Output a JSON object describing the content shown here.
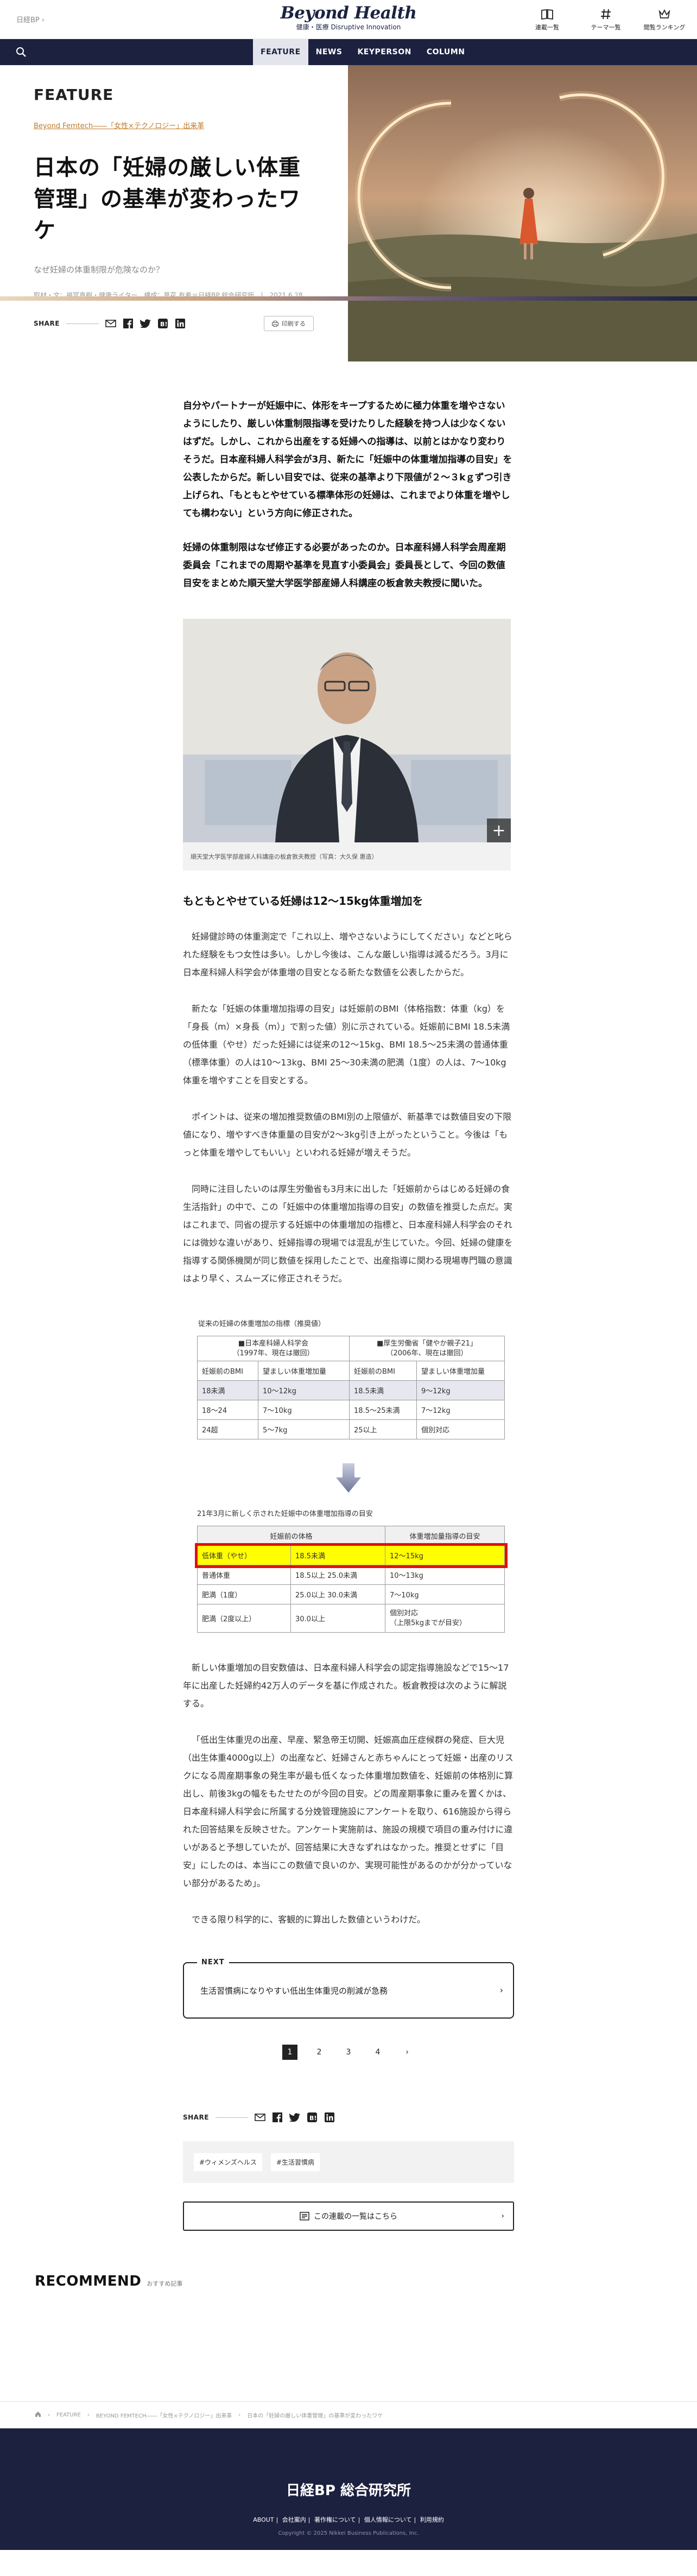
{
  "header": {
    "site_link": "日経BP ›",
    "logo_main": "Beyond Health",
    "logo_sub": "健康・医療  Disruptive Innovation",
    "icons": [
      {
        "icon": "book-icon",
        "label": "連載一覧"
      },
      {
        "icon": "hash-icon",
        "label": "テーマ一覧"
      },
      {
        "icon": "crown-icon",
        "label": "閲覧ランキング"
      }
    ]
  },
  "nav": {
    "tabs": [
      "FEATURE",
      "NEWS",
      "KEYPERSON",
      "COLUMN"
    ],
    "active": "FEATURE"
  },
  "hero": {
    "section_label": "FEATURE",
    "series_link": "Beyond Femtech――「女性×テクノロジー」出来革",
    "title": "日本の「妊婦の厳しい体重管理」の基準が変わったワケ",
    "subtitle": "なぜ妊婦の体重制限が危険なのか？",
    "credit": "取材・文：福冨直樹・健康ライター、構成：草花 有希＝日経BP 総合研究所　|　2021.6.28",
    "share_label": "SHARE",
    "print_label": "印刷する"
  },
  "article": {
    "lead1": "自分やパートナーが妊娠中に、体形をキープするために極力体重を増やさないようにしたり、厳しい体重制限指導を受けたりした経験を持つ人は少なくないはずだ。しかし、これから出産をする妊婦への指導は、以前とはかなり変わりそうだ。日本産科婦人科学会が3月、新たに「妊娠中の体重増加指導の目安」を公表したからだ。新しい目安では、従来の基準より下限値が２～３kｇずつ引き上げられ、「もともとやせている標準体形の妊婦は、これまでより体重を増やしても構わない」という方向に修正された。",
    "lead2": "妊婦の体重制限はなぜ修正する必要があったのか。日本産科婦人科学会周産期委員会「これまでの周期や基準を見直す小委員会」委員長として、今回の数値目安をまとめた順天堂大学医学部産婦人科講座の板倉敦夫教授に聞いた。",
    "photo_caption": "順天堂大学医学部産婦人科講座の板倉敦夫教授（写真：大久保 惠造）",
    "section1_heading": "もともとやせている妊婦は12～15kg体重増加を",
    "para1": "妊婦健診時の体重測定で「これ以上、増やさないようにしてください」などと叱られた経験をもつ女性は多い。しかし今後は、こんな厳しい指導は減るだろう。3月に日本産科婦人科学会が体重増の目安となる新たな数値を公表したからだ。",
    "para2": "新たな「妊娠の体重増加指導の目安」は妊娠前のBMI（体格指数：体重（kg）を「身長（m）×身長（m）」で割った値）別に示されている。妊娠前にBMI 18.5未満の低体重（やせ）だった妊婦には従来の12～15kg、BMI 18.5～25未満の普通体重（標準体重）の人は10～13kg、BMI 25～30未満の肥満（1度）の人は、7～10kg体重を増やすことを目安とする。",
    "para3": "ポイントは、従来の増加推奨数値のBMI別の上限値が、新基準では数値目安の下限値になり、増やすべき体重量の目安が2～3kg引き上がったということ。今後は「もっと体重を増やしてもいい」といわれる妊婦が増えそうだ。",
    "para4": "同時に注目したいのは厚生労働省も3月末に出した「妊娠前からはじめる妊婦の食生活指針」の中で、この「妊娠中の体重増加指導の目安」の数値を推奨した点だ。実はこれまで、同省の提示する妊娠中の体重増加の指標と、日本産科婦人科学会のそれには微妙な違いがあり、妊婦指導の現場では混乱が生じていた。今回、妊婦の健康を指導する関係機関が同じ数値を採用したことで、出産指導に関わる現場専門職の意識はより早く、スムーズに修正されそうだ。",
    "table1": {
      "title": "従来の妊婦の体重増加の指標（推奨値）",
      "group_a": "■日本産科婦人科学会\n（1997年、現在は撤回）",
      "group_b": "■厚生労働省「健やか親子21」\n（2006年、現在は撤回）",
      "col_bmi": "妊娠前のBMI",
      "col_gain": "望ましい体重増加量",
      "rows": [
        [
          "18未満",
          "10～12kg",
          "18.5未満",
          "9～12kg"
        ],
        [
          "18～24",
          "7～10kg",
          "18.5～25未満",
          "7～12kg"
        ],
        [
          "24超",
          "5～7kg",
          "25以上",
          "個別対応"
        ]
      ]
    },
    "table2": {
      "title": "21年3月に新しく示された妊娠中の体重増加指導の目安",
      "col_a": "妊娠前の体格",
      "col_b": "体重増加量指導の目安",
      "rows": [
        [
          "低体重（やせ）",
          "18.5未満",
          "12～15kg"
        ],
        [
          "普通体重",
          "18.5以上 25.0未満",
          "10～13kg"
        ],
        [
          "肥満（1度）",
          "25.0以上 30.0未満",
          "7～10kg"
        ],
        [
          "肥満（2度以上）",
          "30.0以上",
          "個別対応\n（上限5kgまでが目安）"
        ]
      ]
    },
    "para5": "新しい体重増加の目安数値は、日本産科婦人科学会の認定指導施設などで15～17年に出産した妊婦約42万人のデータを基に作成された。板倉教授は次のように解説する。",
    "para6": "「低出生体重児の出産、早産、緊急帝王切開、妊娠高血圧症候群の発症、巨大児（出生体重4000g以上）の出産など、妊婦さんと赤ちゃんにとって妊娠・出産のリスクになる周産期事象の発生率が最も低くなった体重増加数値を、妊娠前の体格別に算出し、前後3kgの幅をもたせたのが今回の目安。どの周産期事象に重みを置くかは、日本産科婦人科学会に所属する分娩管理施設にアンケートを取り、616施設から得られた回答結果を反映させた。アンケート実施前は、施設の規模で項目の重み付けに違いがあると予想していたが、回答結果に大きなずれはなかった。推奨とせずに「目安」にしたのは、本当にこの数値で良いのか、実現可能性があるのかが分かっていない部分があるため」。",
    "para7": "できる限り科学的に、客観的に算出した数値というわけだ。",
    "next_label": "NEXT",
    "next_text": "生活習慣病になりやすい低出生体重児の削減が急務",
    "pages": [
      "1",
      "2",
      "3",
      "4"
    ],
    "current_page": "1",
    "share_label": "SHARE",
    "tags": [
      "#ウィメンズヘルス",
      "#生活習慣病"
    ],
    "series_button": "この連載の一覧はこちら"
  },
  "recommend": {
    "title": "RECOMMEND",
    "subtitle": "おすすめ記事"
  },
  "bottom_breadcrumb": [
    "FEATURE",
    "BEYOND FEMTECH――「女性×テクノロジー」出来革",
    "日本の「妊婦の厳しい体重管理」の基準が変わったワケ"
  ],
  "footer": {
    "logo": "日経BP 総合研究所",
    "links": [
      "ABOUT",
      "会社案内",
      "著作権について",
      "個人情報について",
      "利用規約"
    ],
    "copyright": "Copyright © 2025 Nikkei Business Publications, Inc."
  },
  "colors": {
    "navy": "#1d2140",
    "accent": "#c07a25",
    "highlight": "#ffff00",
    "highlight_border": "#e01010"
  }
}
